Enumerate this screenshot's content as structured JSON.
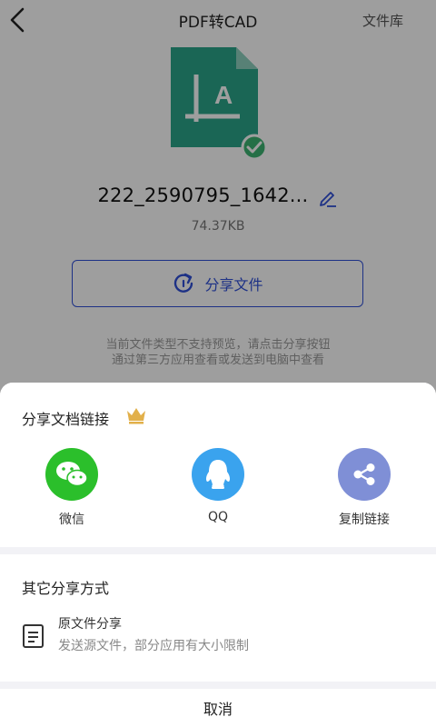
{
  "header": {
    "title": "PDF转CAD",
    "library_label": "文件库"
  },
  "file": {
    "name": "222_2590795_1642...",
    "size": "74.37KB"
  },
  "main": {
    "share_button_label": "分享文件",
    "notice_line1": "当前文件类型不支持预览，请点击分享按钮",
    "notice_line2": "通过第三方应用查看或发送到电脑中查看"
  },
  "share_sheet": {
    "link_section_title": "分享文档链接",
    "options": [
      {
        "label": "微信",
        "icon": "wechat-icon",
        "color": "#2bbf2b"
      },
      {
        "label": "QQ",
        "icon": "qq-icon",
        "color": "#3aa3ee"
      },
      {
        "label": "复制链接",
        "icon": "share-link-icon",
        "color": "#7f8fd6"
      }
    ],
    "other_section_title": "其它分享方式",
    "original_file": {
      "title": "原文件分享",
      "description": "发送源文件，部分应用有大小限制"
    },
    "cancel_label": "取消"
  },
  "colors": {
    "accent": "#2f4fd8",
    "file_icon": "#2aa58a",
    "check_badge": "#3cb371",
    "crown": "#e2b04a"
  }
}
